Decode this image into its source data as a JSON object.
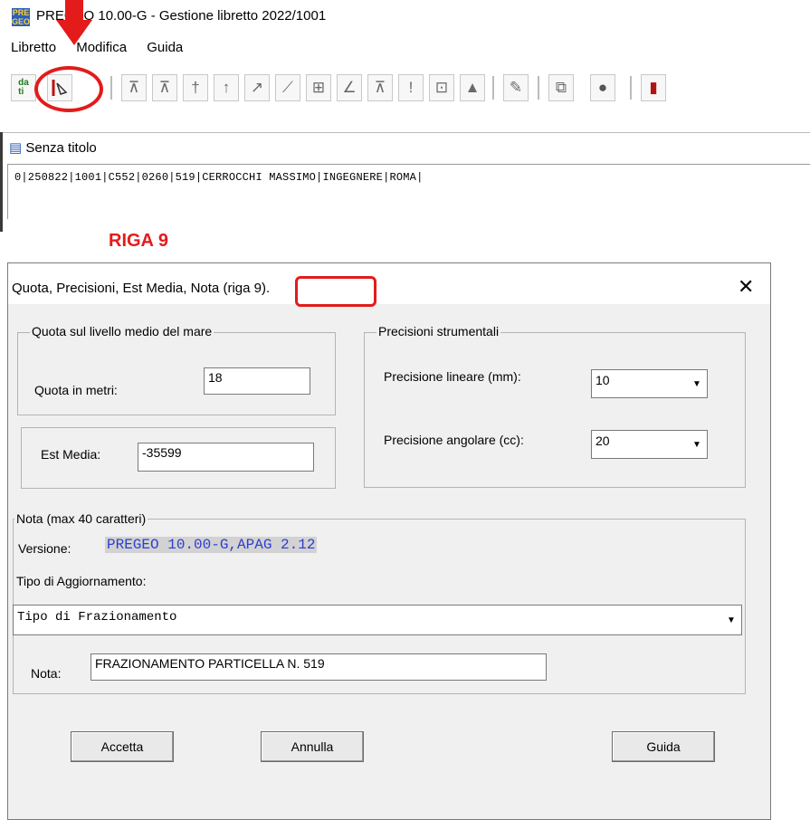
{
  "app": {
    "title": "PREGEO 10.00-G - Gestione libretto 2022/1001",
    "menu": [
      "Libretto",
      "Modifica",
      "Guida"
    ]
  },
  "toolbar": {
    "buttons": [
      "dati-tipo",
      "redraw",
      "t1",
      "t2",
      "t3",
      "t4",
      "t5",
      "t6",
      "t7",
      "t8",
      "t9",
      "t10",
      "t11",
      "t12",
      "t13",
      "t14",
      "t15",
      "t16"
    ]
  },
  "annotation": {
    "label": "RIGA 9",
    "color": "#e31b1b"
  },
  "document": {
    "title": "Senza titolo",
    "line": "0|250822|1001|C552|0260|519|CERROCCHI MASSIMO|INGEGNERE|ROMA|"
  },
  "dialog": {
    "title_main": "Quota, Precisioni, Est Media, Nota",
    "title_riga": "(riga 9).",
    "quota_group": "Quota sul livello medio del mare",
    "quota_label": "Quota in metri:",
    "quota_value": "18",
    "est_label": "Est Media:",
    "est_value": "-35599",
    "prec_group": "Precisioni strumentali",
    "prec_lin_label": "Precisione lineare (mm):",
    "prec_lin_value": "10",
    "prec_ang_label": "Precisione  angolare (cc):",
    "prec_ang_value": "20",
    "nota_group": "Nota (max 40 caratteri)",
    "versione_label": "Versione:",
    "versione_value": "PREGEO 10.00-G,APAG 2.12",
    "tipo_label": "Tipo di Aggiornamento:",
    "tipo_value": "Tipo di Frazionamento",
    "nota_label": "Nota:",
    "nota_value": "FRAZIONAMENTO PARTICELLA N. 519",
    "btn_accetta": "Accetta",
    "btn_annulla": "Annulla",
    "btn_guida": "Guida"
  }
}
